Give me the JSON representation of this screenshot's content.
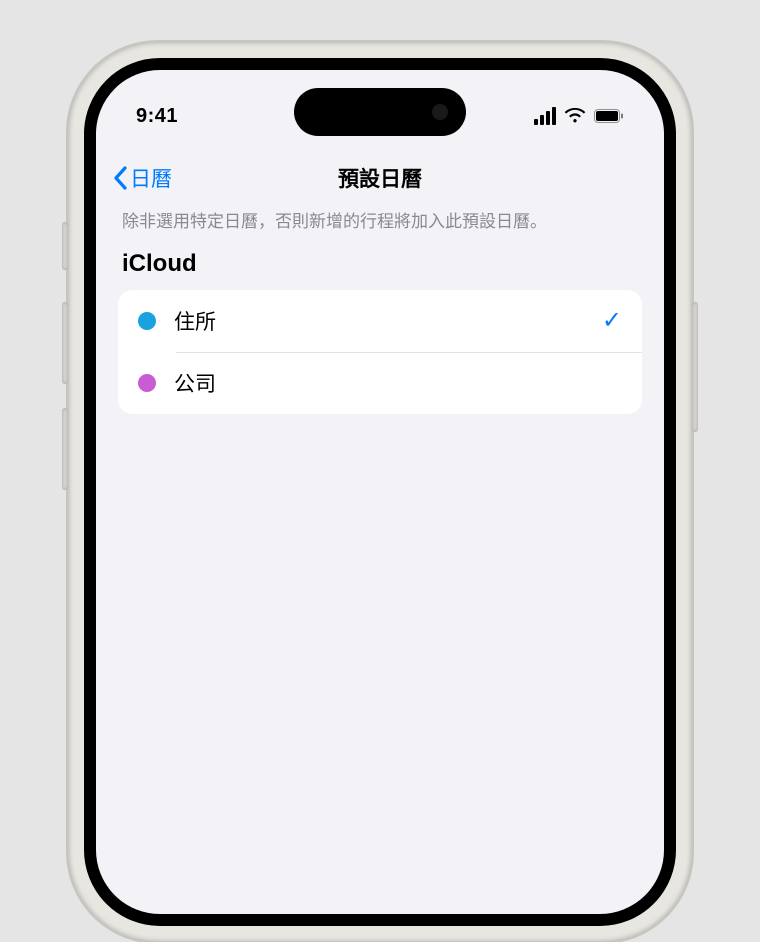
{
  "status": {
    "time": "9:41"
  },
  "nav": {
    "back_label": "日曆",
    "title": "預設日曆"
  },
  "description": "除非選用特定日曆，否則新增的行程將加入此預設日曆。",
  "section": {
    "header": "iCloud"
  },
  "calendars": [
    {
      "label": "住所",
      "color": "#1aa2e0",
      "selected": true
    },
    {
      "label": "公司",
      "color": "#c95bd4",
      "selected": false
    }
  ],
  "checkmark": "✓"
}
